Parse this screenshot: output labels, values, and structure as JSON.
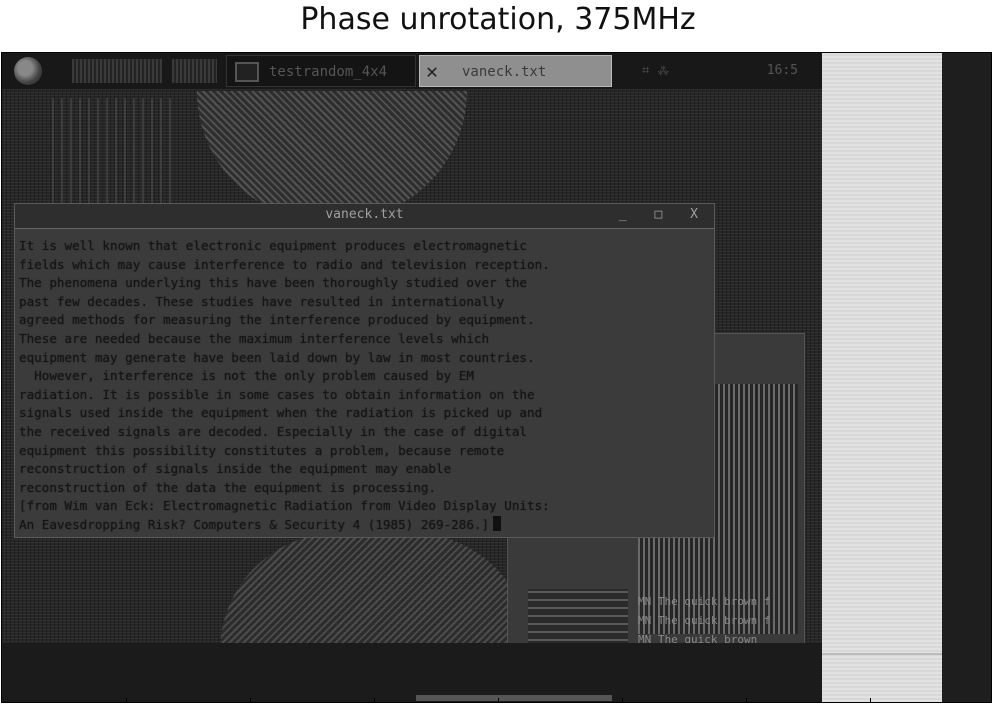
{
  "title": "Phase unrotation, 375MHz",
  "taskbar": {
    "items": [
      {
        "label": "testrandom_4x4"
      },
      {
        "label": "vaneck.txt"
      }
    ],
    "clock": "16:5"
  },
  "editor": {
    "title": "vaneck.txt",
    "controls": "_ □ X",
    "lines": [
      "It is well known that electronic equipment produces electromagnetic",
      "fields which may cause interference to radio and television reception.",
      "The phenomena underlying this have been thoroughly studied over the",
      "past few decades. These studies have resulted in internationally",
      "agreed methods for measuring the interference produced by equipment.",
      "These are needed because the maximum interference levels which",
      "equipment may generate have been laid down by law in most countries.",
      "  However, interference is not the only problem caused by EM",
      "radiation. It is possible in some cases to obtain information on the",
      "signals used inside the equipment when the radiation is picked up and",
      "the received signals are decoded. Especially in the case of digital",
      "equipment this possibility constitutes a problem, because remote",
      "reconstruction of signals inside the equipment may enable",
      "reconstruction of the data the equipment is processing.",
      "[from Wim van Eck: Electromagnetic Radiation from Video Display Units:",
      "An Eavesdropping Risk? Computers & Security 4 (1985) 269-286.]"
    ]
  },
  "bg_window": {
    "lines": [
      "MN The quick brown f",
      "MN The quick brown f",
      "MN The quick brown"
    ]
  }
}
